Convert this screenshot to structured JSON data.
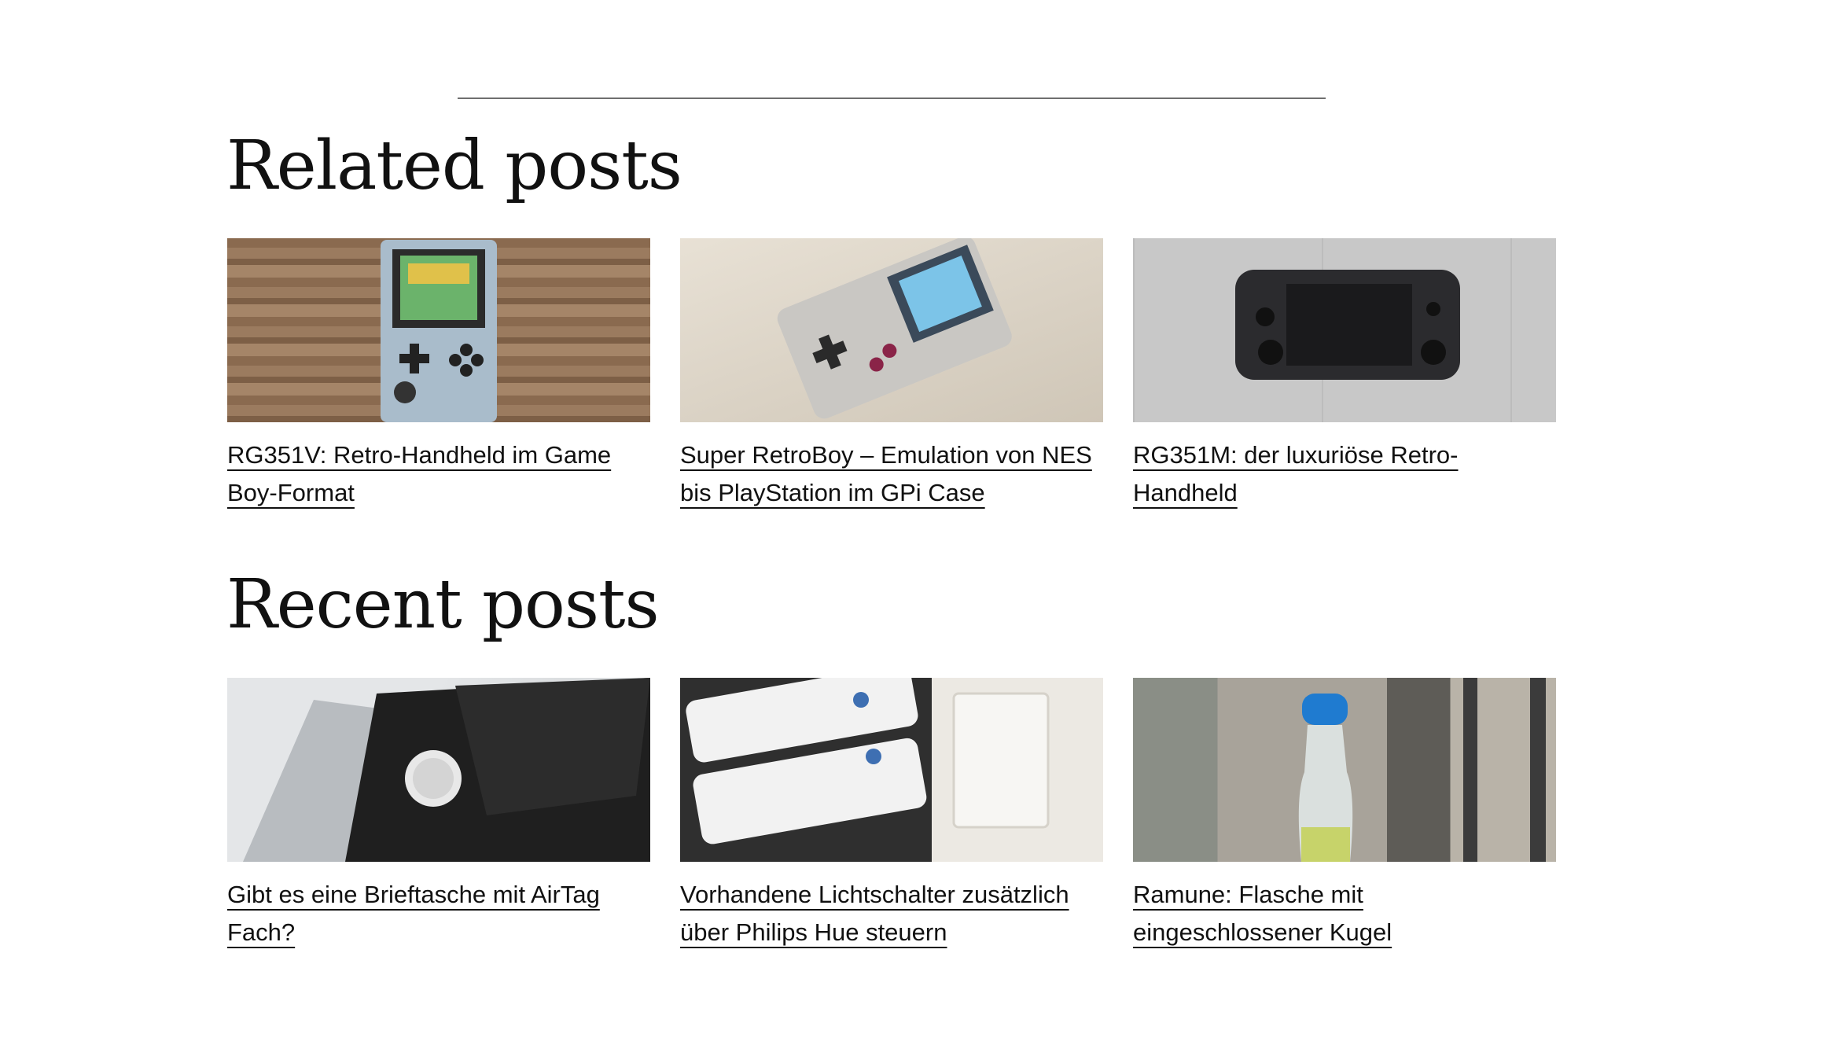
{
  "related": {
    "heading": "Related posts",
    "posts": [
      {
        "title": "RG351V: Retro-Handheld im Game Boy-Format",
        "image": "retro-handheld-thumbnail"
      },
      {
        "title": "Super RetroBoy – Emulation von NES bis PlayStation im GPi Case",
        "image": "gpi-case-thumbnail"
      },
      {
        "title": "RG351M: der luxuriöse Retro-Handheld",
        "image": "rg351m-thumbnail"
      }
    ]
  },
  "recent": {
    "heading": "Recent posts",
    "posts": [
      {
        "title": "Gibt es eine Brieftasche mit AirTag Fach?",
        "image": "wallet-airtag-thumbnail"
      },
      {
        "title": "Vorhandene Lichtschalter zusätzlich über Philips Hue steuern",
        "image": "philips-hue-thumbnail"
      },
      {
        "title": "Ramune: Flasche mit eingeschlossener Kugel",
        "image": "ramune-bottle-thumbnail"
      }
    ]
  }
}
